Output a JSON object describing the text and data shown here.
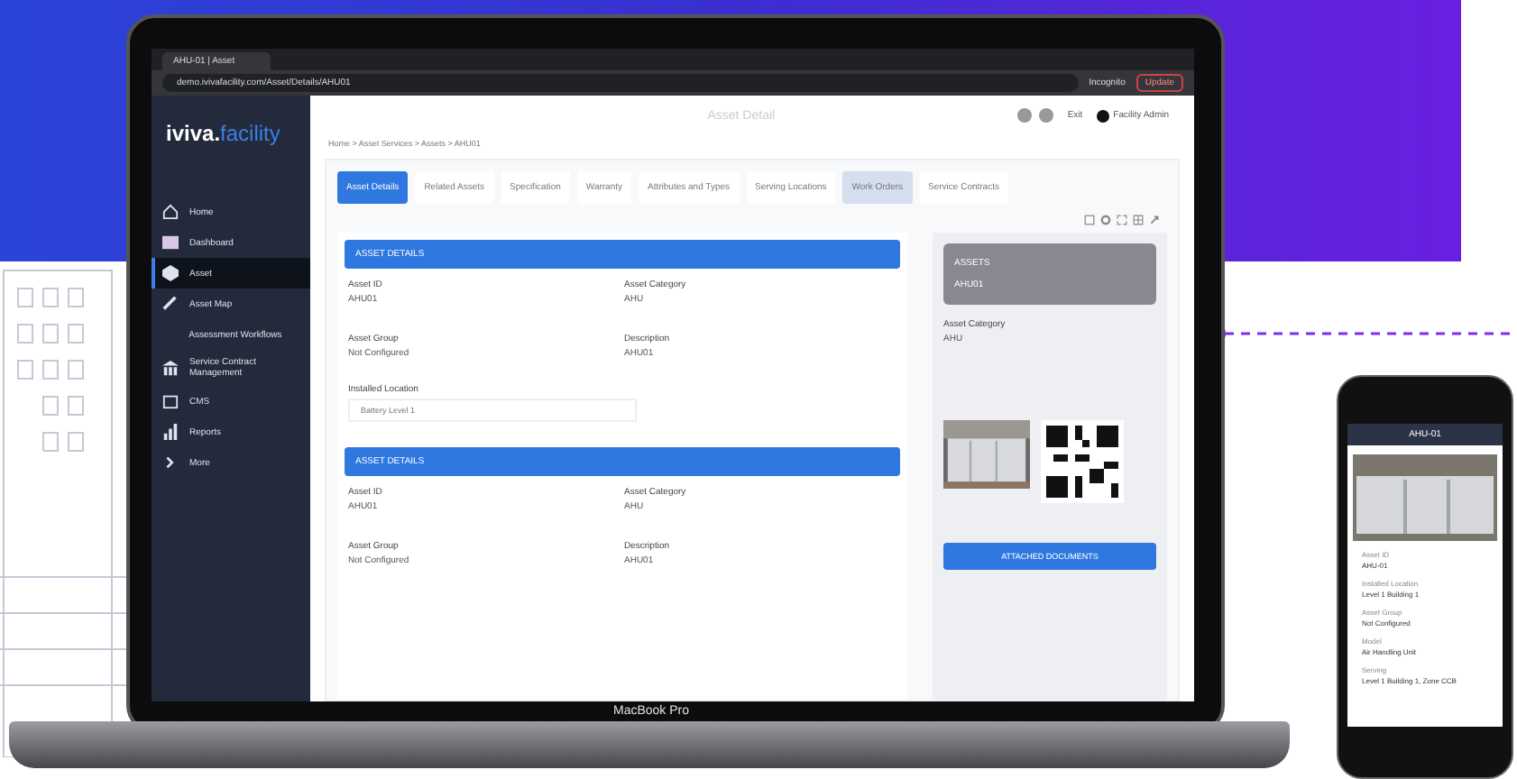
{
  "browser": {
    "tab_title": "AHU-01 | Asset",
    "url": "demo.ivivafacility.com/Asset/Details/AHU01",
    "profile": "Incognito",
    "update": "Update"
  },
  "sidebar": {
    "logo_main": "iviva.",
    "logo_accent": "facility",
    "items": [
      {
        "label": "Home",
        "selected": false
      },
      {
        "label": "Dashboard",
        "selected": false
      },
      {
        "label": "Asset",
        "selected": true
      },
      {
        "label": "Asset Map",
        "selected": false
      },
      {
        "label": "Assessment Workflows",
        "selected": false
      },
      {
        "label": "Service Contract Management",
        "selected": false
      },
      {
        "label": "CMS",
        "selected": false
      },
      {
        "label": "Reports",
        "selected": false
      },
      {
        "label": "More",
        "selected": false
      }
    ]
  },
  "header": {
    "title": "Asset Detail",
    "exit": "Exit",
    "user": "Facility Admin"
  },
  "breadcrumb": "Home  >  Asset Services  >  Assets  >  AHU01",
  "tabs": [
    {
      "label": "Asset Details",
      "selected": true,
      "highlighted": false
    },
    {
      "label": "Related Assets",
      "selected": false,
      "highlighted": false
    },
    {
      "label": "Specification",
      "selected": false,
      "highlighted": false
    },
    {
      "label": "Warranty",
      "selected": false,
      "highlighted": false
    },
    {
      "label": "Attributes and Types",
      "selected": false,
      "highlighted": false
    },
    {
      "label": "Serving Locations",
      "selected": false,
      "highlighted": false
    },
    {
      "label": "Work Orders",
      "selected": false,
      "highlighted": true
    },
    {
      "label": "Service Contracts",
      "selected": false,
      "highlighted": false
    }
  ],
  "sections": [
    {
      "title": "ASSET DETAILS",
      "fields": [
        {
          "label": "Asset ID",
          "value": "AHU01"
        },
        {
          "label": "Asset Category",
          "value": "AHU"
        },
        {
          "label": "Asset Group",
          "value": "Not Configured"
        },
        {
          "label": "Description",
          "value": "AHU01"
        }
      ],
      "location_label": "Installed Location",
      "location_value": "Battery Level 1"
    },
    {
      "title": "ASSET DETAILS",
      "fields": [
        {
          "label": "Asset ID",
          "value": "AHU01"
        },
        {
          "label": "Asset Category",
          "value": "AHU"
        },
        {
          "label": "Asset Group",
          "value": "Not Configured"
        },
        {
          "label": "Description",
          "value": "AHU01"
        }
      ]
    }
  ],
  "side_card": {
    "kind_label": "ASSETS",
    "name": "AHU01",
    "category_label": "Asset Category",
    "category_value": "AHU",
    "button": "ATTACHED DOCUMENTS"
  },
  "laptop_label": "MacBook Pro",
  "phone": {
    "title": "AHU-01",
    "fields": [
      {
        "label": "Asset ID",
        "value": "AHU-01"
      },
      {
        "label": "Installed Location",
        "value": "Level 1 Building 1"
      },
      {
        "label": "Asset Group",
        "value": "Not Configured"
      },
      {
        "label": "Model",
        "value": "Air Handling Unit"
      },
      {
        "label": "Serving",
        "value": "Level 1 Building 1, Zone CCB"
      }
    ]
  }
}
